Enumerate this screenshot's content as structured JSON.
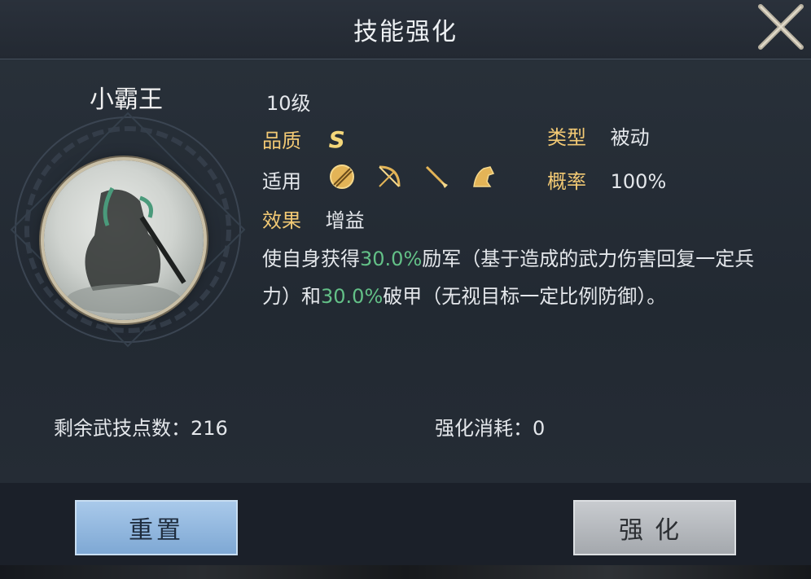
{
  "title": "技能强化",
  "hero": {
    "name": "小霸王"
  },
  "skill": {
    "level": "10级",
    "quality_label": "品质",
    "quality_value": "S",
    "type_label": "类型",
    "type_value": "被动",
    "applicable_label": "适用",
    "applicable_icons": [
      "shield-icon",
      "bow-icon",
      "spear-icon",
      "horse-icon"
    ],
    "chance_label": "概率",
    "chance_value": "100%",
    "effect_label": "效果",
    "effect_value": "增益",
    "desc": {
      "part1": "使自身获得",
      "pct1": "30.0%",
      "part2": "励军（基于造成的武力伤害回复一定兵力）和",
      "pct2": "30.0%",
      "part3": "破甲（无视目标一定比例防御）。"
    }
  },
  "footer_info": {
    "points_label": "剩余武技点数：",
    "points_value": "216",
    "cost_label": "强化消耗：",
    "cost_value": "0"
  },
  "buttons": {
    "reset": "重置",
    "enhance": "强化"
  },
  "colors": {
    "accent_gold": "#f2c974",
    "highlight_green": "#63c087",
    "reset_button": "#8fb6de",
    "enhance_button": "#b4b8bc"
  }
}
